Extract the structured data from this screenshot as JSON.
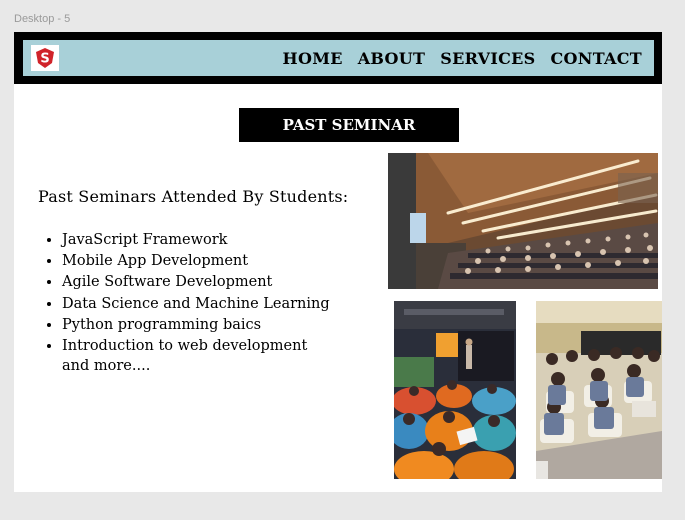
{
  "frame": {
    "label": "Desktop - 5"
  },
  "nav": {
    "logo_letter": "S",
    "items": [
      {
        "label": "HOME"
      },
      {
        "label": "ABOUT"
      },
      {
        "label": "SERVICES"
      },
      {
        "label": "CONTACT"
      }
    ]
  },
  "section": {
    "title": "PAST SEMINAR"
  },
  "content": {
    "heading": "Past Seminars Attended By Students:",
    "items": [
      " JavaScript Framework",
      "Mobile App Development",
      "Agile Software Development",
      "Data Science and Machine Learning",
      "Python programming baics",
      "Introduction to web development"
    ],
    "more": "and more...."
  },
  "colors": {
    "nav_background": "#000000",
    "nav_bar": "#a8d0d8",
    "logo_red": "#d0232a",
    "title_background": "#000000"
  }
}
